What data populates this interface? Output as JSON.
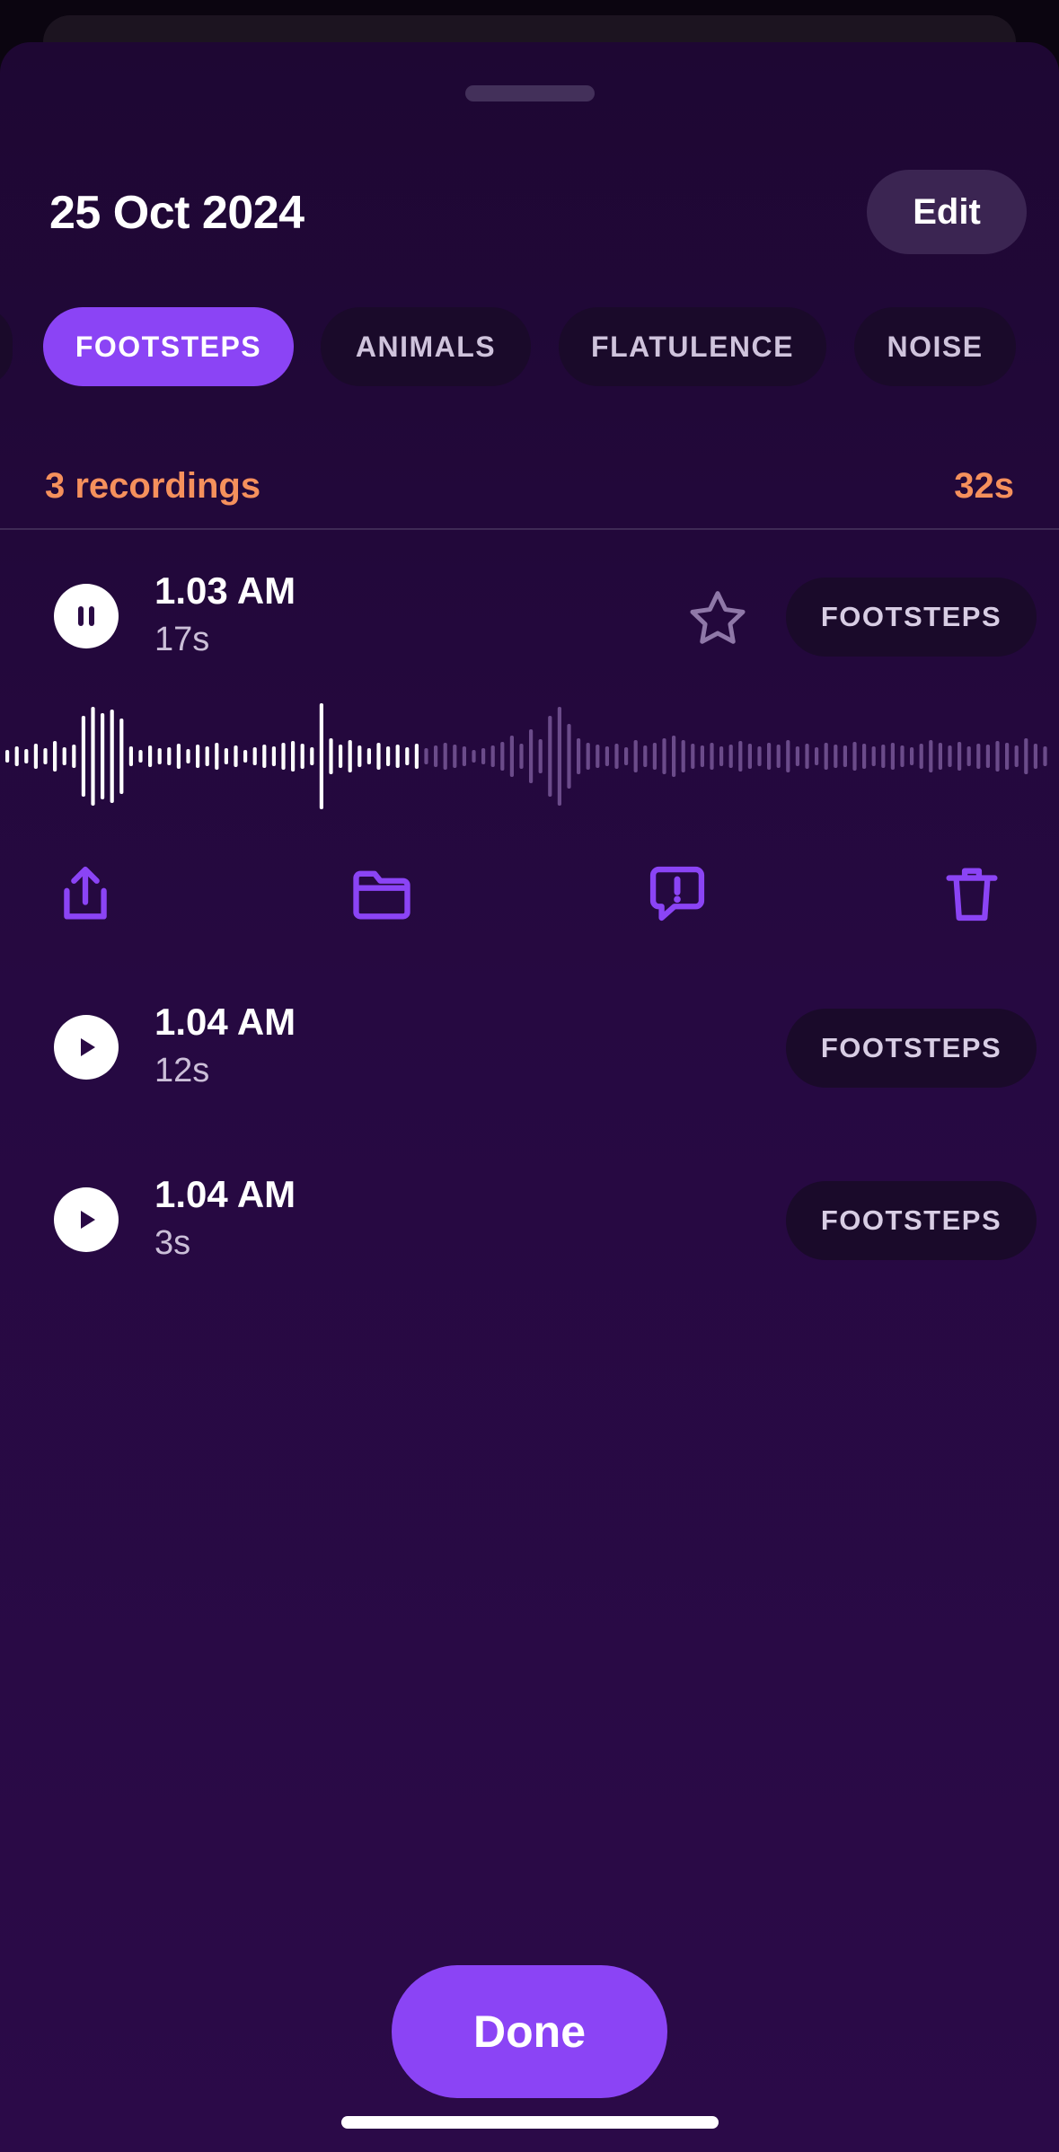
{
  "sheet": {
    "title": "25 Oct 2024",
    "edit_label": "Edit"
  },
  "categories": [
    {
      "label": "",
      "active": false
    },
    {
      "label": "FOOTSTEPS",
      "active": true
    },
    {
      "label": "ANIMALS",
      "active": false
    },
    {
      "label": "FLATULENCE",
      "active": false
    },
    {
      "label": "NOISE",
      "active": false
    }
  ],
  "summary": {
    "count_label": "3 recordings",
    "total_duration": "32s"
  },
  "recordings": [
    {
      "time": "1.03 AM",
      "duration": "17s",
      "tag": "FOOTSTEPS",
      "state": "playing",
      "starred": false,
      "progress": 0.4
    },
    {
      "time": "1.04 AM",
      "duration": "12s",
      "tag": "FOOTSTEPS",
      "state": "paused"
    },
    {
      "time": "1.04 AM",
      "duration": "3s",
      "tag": "FOOTSTEPS",
      "state": "paused"
    }
  ],
  "actions": [
    {
      "name": "share-icon"
    },
    {
      "name": "folder-icon"
    },
    {
      "name": "report-icon"
    },
    {
      "name": "trash-icon"
    }
  ],
  "footer": {
    "done_label": "Done"
  },
  "colors": {
    "accent": "#8b44f5",
    "summary": "#f5905c",
    "wave_played": "#ffffff",
    "wave_unplayed": "#6b4b8a"
  }
}
